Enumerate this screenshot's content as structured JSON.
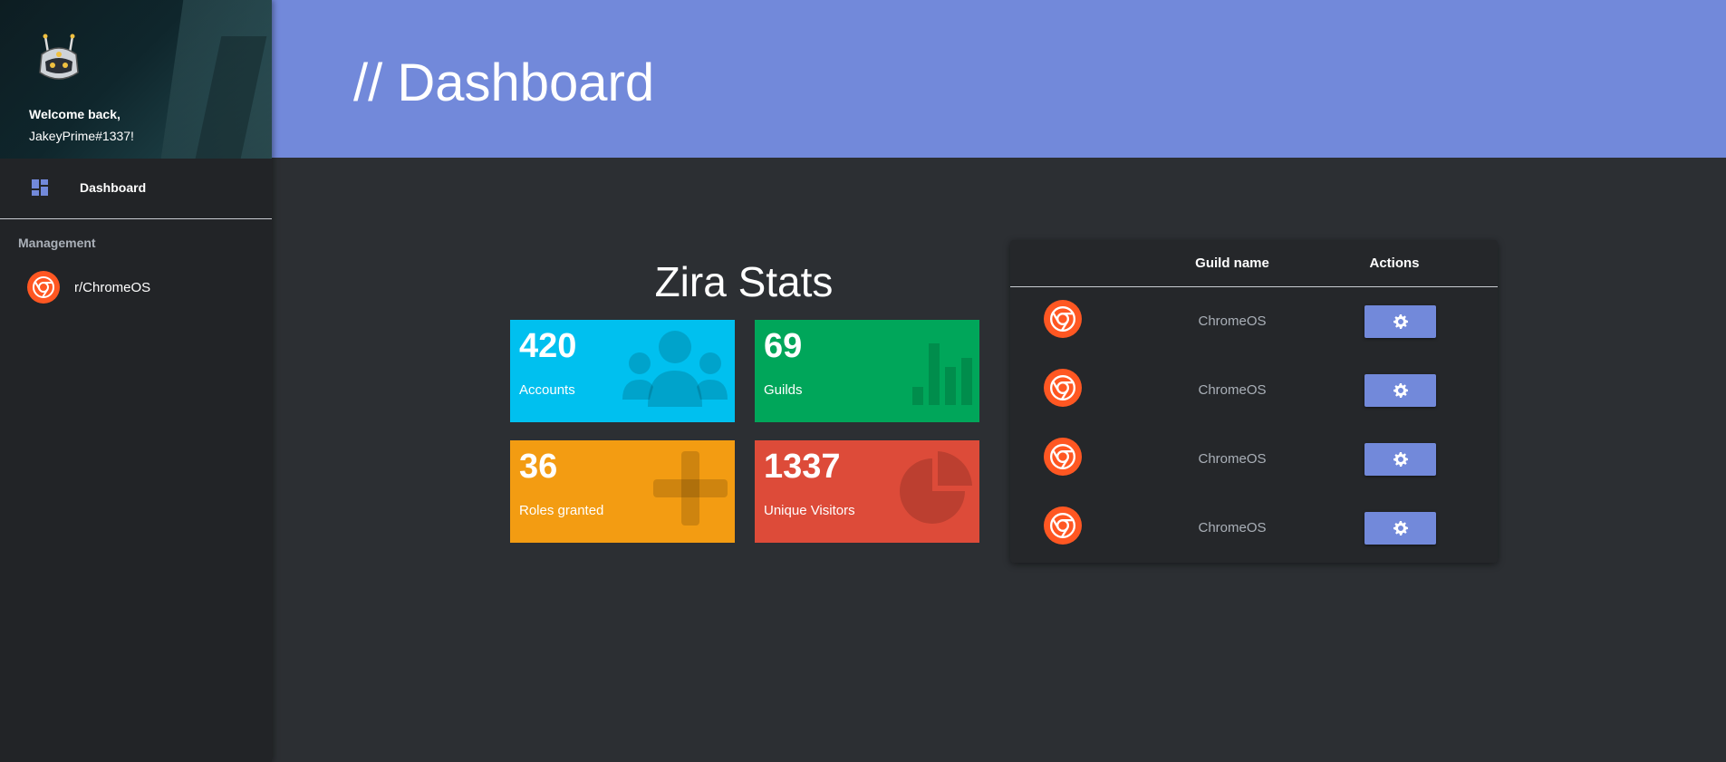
{
  "sidebar": {
    "welcome_line1": "Welcome back,",
    "username": "JakeyPrime#1337!",
    "nav": [
      {
        "label": "Dashboard",
        "icon": "dashboard-icon"
      }
    ],
    "section_label": "Management",
    "guilds": [
      {
        "label": "r/ChromeOS",
        "icon": "chrome-icon"
      }
    ]
  },
  "header": {
    "title": "// Dashboard"
  },
  "stats": {
    "title": "Zira Stats",
    "cards": [
      {
        "value": "420",
        "label": "Accounts",
        "icon": "users-icon",
        "color": "#00c0ef"
      },
      {
        "value": "69",
        "label": "Guilds",
        "icon": "bar-chart-icon",
        "color": "#00a65a"
      },
      {
        "value": "36",
        "label": "Roles granted",
        "icon": "plus-icon",
        "color": "#f39c12"
      },
      {
        "value": "1337",
        "label": "Unique Visitors",
        "icon": "pie-chart-icon",
        "color": "#dd4b39"
      }
    ]
  },
  "table": {
    "headers": {
      "name": "Guild name",
      "actions": "Actions"
    },
    "rows": [
      {
        "name": "ChromeOS",
        "icon": "chrome-icon",
        "action_icon": "gear-icon"
      },
      {
        "name": "ChromeOS",
        "icon": "chrome-icon",
        "action_icon": "gear-icon"
      },
      {
        "name": "ChromeOS",
        "icon": "chrome-icon",
        "action_icon": "gear-icon"
      },
      {
        "name": "ChromeOS",
        "icon": "chrome-icon",
        "action_icon": "gear-icon"
      }
    ]
  },
  "colors": {
    "accent": "#7289da",
    "sidebar": "#222427",
    "background": "#2c2f33",
    "chrome_orange": "#ff5722"
  }
}
